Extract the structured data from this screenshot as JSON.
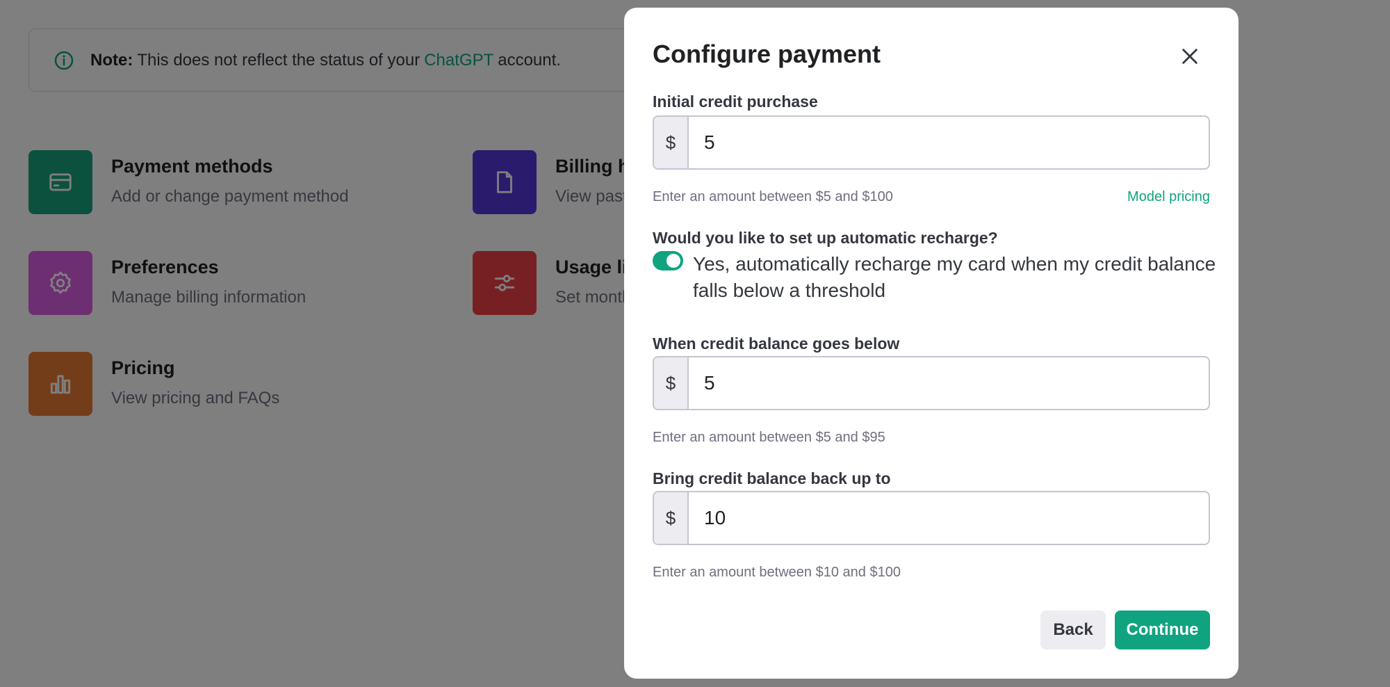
{
  "background": {
    "note": {
      "bold": "Note:",
      "text_before": "This does not reflect the status of your",
      "link": "ChatGPT",
      "text_after": "account."
    },
    "cards": [
      {
        "title": "Payment methods",
        "subtitle": "Add or change payment method",
        "icon": "credit-card-icon",
        "color": "#19a37a"
      },
      {
        "title": "Billing h",
        "subtitle": "View past",
        "icon": "document-icon",
        "color": "#5436da"
      },
      {
        "title": "Preferences",
        "subtitle": "Manage billing information",
        "icon": "gear-icon",
        "color": "#dd5ce5"
      },
      {
        "title": "Usage li",
        "subtitle": "Set month",
        "icon": "sliders-icon",
        "color": "#ef4146"
      },
      {
        "title": "Pricing",
        "subtitle": "View pricing and FAQs",
        "icon": "bar-chart-icon",
        "color": "#e87b35"
      }
    ]
  },
  "modal": {
    "title": "Configure payment",
    "initial": {
      "label": "Initial credit purchase",
      "prefix": "$",
      "value": "5",
      "hint": "Enter an amount between $5 and $100",
      "link": "Model pricing"
    },
    "recharge": {
      "question": "Would you like to set up automatic recharge?",
      "toggle_on": true,
      "toggle_label": "Yes, automatically recharge my card when my credit balance falls below a threshold"
    },
    "threshold": {
      "label": "When credit balance goes below",
      "prefix": "$",
      "value": "5",
      "hint": "Enter an amount between $5 and $95"
    },
    "target": {
      "label": "Bring credit balance back up to",
      "prefix": "$",
      "value": "10",
      "hint": "Enter an amount between $10 and $100"
    },
    "buttons": {
      "back": "Back",
      "continue": "Continue"
    }
  },
  "colors": {
    "accent": "#10a37f",
    "overlay": "rgba(0,0,0,0.5)"
  }
}
